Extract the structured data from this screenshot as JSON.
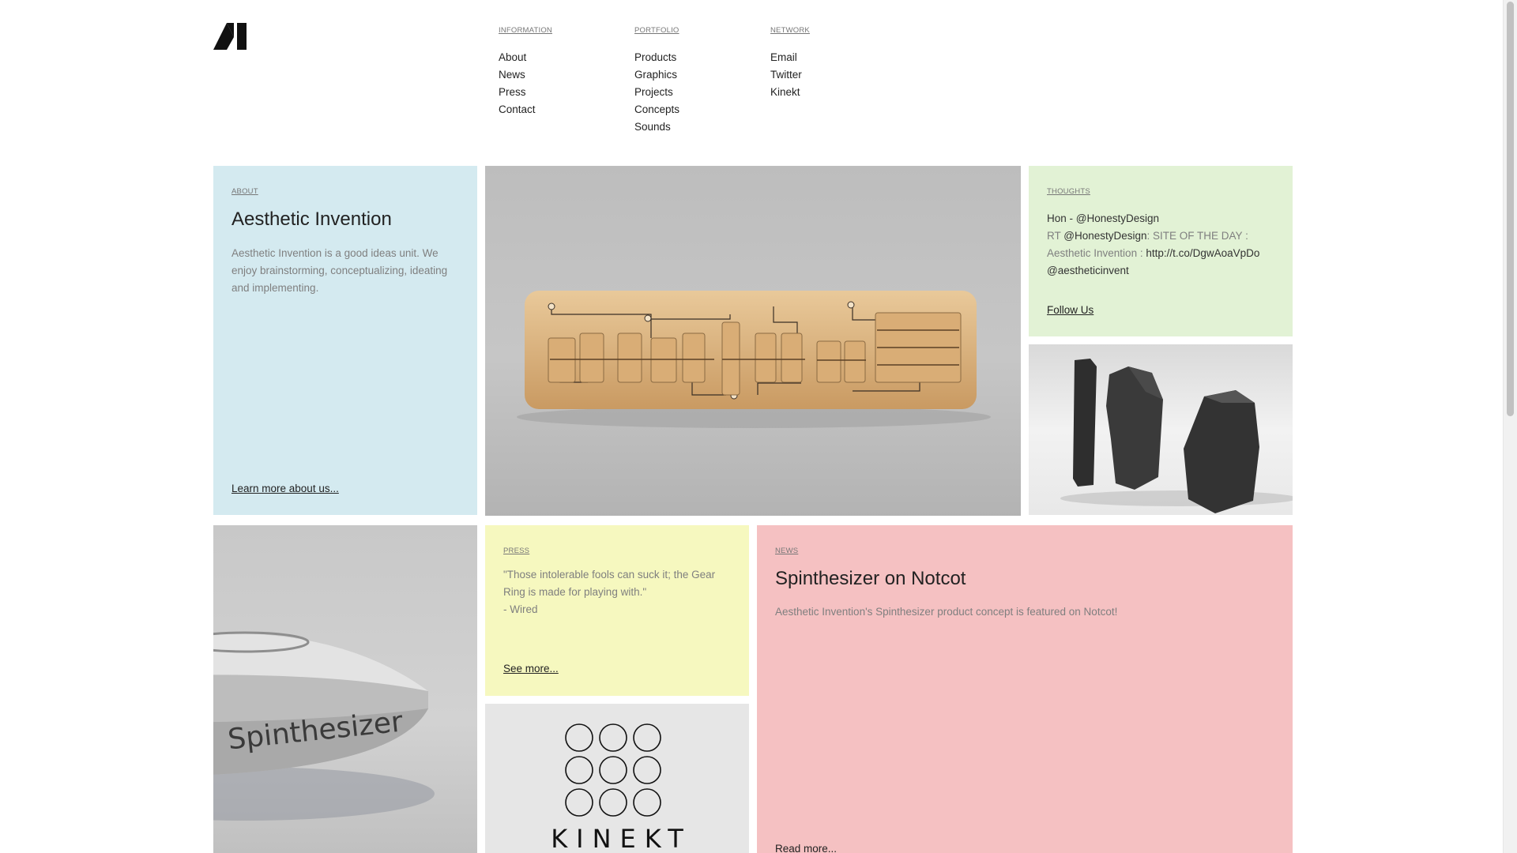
{
  "header": {
    "logo_icon": "ai-triangle-logo",
    "nav": [
      {
        "heading": "INFORMATION",
        "items": [
          "About",
          "News",
          "Press",
          "Contact"
        ]
      },
      {
        "heading": "PORTFOLIO",
        "items": [
          "Products",
          "Graphics",
          "Projects",
          "Concepts",
          "Sounds"
        ]
      },
      {
        "heading": "NETWORK",
        "items": [
          "Email",
          "Twitter",
          "Kinekt"
        ]
      }
    ]
  },
  "about": {
    "label": "ABOUT",
    "title": "Aesthetic Invention",
    "body": "Aesthetic Invention is a good ideas unit. We enjoy brainstorming, conceptualizing, ideating and implementing.",
    "link": "Learn more about us...",
    "bg": "#d4eaf0"
  },
  "thoughts": {
    "label": "THOUGHTS",
    "author": "Hon - @HonestyDesign",
    "rt_prefix": "RT",
    "rt_handle": "@HonestyDesign",
    "rt_text_1": ": SITE OF THE DAY :",
    "rt_text_2": "Aesthetic Invention :",
    "rt_url": "http://t.co/DgwAoaVpDo",
    "rt_mention": "@aestheticinvent",
    "link": "Follow Us",
    "bg": "#e2f2d5"
  },
  "press": {
    "label": "PRESS",
    "quote": "\"Those intolerable fools can suck it; the Gear Ring is made for playing with.\"",
    "source": "- Wired",
    "link": "See more...",
    "bg": "#f6f8bf"
  },
  "news": {
    "label": "NEWS",
    "title": "Spinthesizer on Notcot",
    "body": "Aesthetic Invention's Spinthesizer product concept is featured on Notcot!",
    "link": "Read more...",
    "bg": "#f5c1c2"
  },
  "images": {
    "product_text": "Spinthesizer",
    "kinekt_text": "KINEKT"
  }
}
